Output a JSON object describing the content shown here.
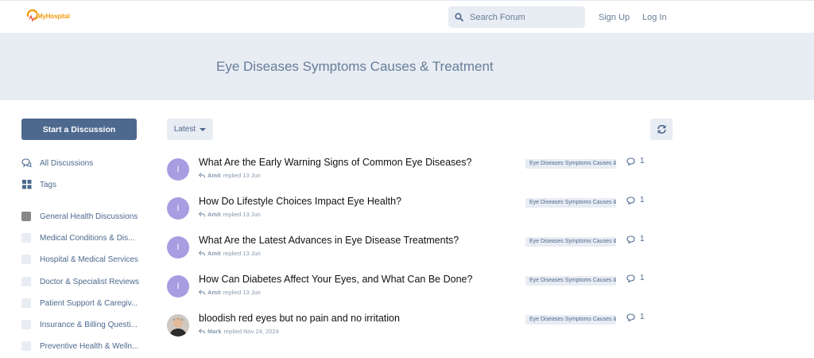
{
  "header": {
    "logo_text": "MyHospital",
    "search_placeholder": "Search Forum",
    "sign_up": "Sign Up",
    "log_in": "Log In"
  },
  "hero": {
    "title": "Eye Diseases Symptoms Causes & Treatment"
  },
  "sidebar": {
    "start_button": "Start a Discussion",
    "nav": [
      {
        "label": "All Discussions",
        "icon": "comments-icon"
      },
      {
        "label": "Tags",
        "icon": "grid-icon"
      }
    ],
    "tags": [
      {
        "label": "General Health Discussions",
        "color": "#888888"
      },
      {
        "label": "Medical Conditions & Dis...",
        "color": "#e8ecf3"
      },
      {
        "label": "Hospital & Medical Services",
        "color": "#e8ecf3"
      },
      {
        "label": "Doctor & Specialist Reviews",
        "color": "#e8ecf3"
      },
      {
        "label": "Patient Support & Caregiv...",
        "color": "#e8ecf3"
      },
      {
        "label": "Insurance & Billing Questi...",
        "color": "#e8ecf3"
      },
      {
        "label": "Preventive Health & Welln...",
        "color": "#e8ecf3"
      }
    ]
  },
  "toolbar": {
    "sort_label": "Latest"
  },
  "discussions": [
    {
      "title": "What Are the Early Warning Signs of Common Eye Diseases?",
      "avatar": "I",
      "user": "Amit",
      "action": "replied",
      "date": "13 Jun",
      "tag": "Eye Diseases Symptoms Causes & Treatment",
      "replies": "1"
    },
    {
      "title": "How Do Lifestyle Choices Impact Eye Health?",
      "avatar": "I",
      "user": "Amit",
      "action": "replied",
      "date": "13 Jun",
      "tag": "Eye Diseases Symptoms Causes & Treatment",
      "replies": "1"
    },
    {
      "title": "What Are the Latest Advances in Eye Disease Treatments?",
      "avatar": "I",
      "user": "Amit",
      "action": "replied",
      "date": "13 Jun",
      "tag": "Eye Diseases Symptoms Causes & Treatment",
      "replies": "1"
    },
    {
      "title": "How Can Diabetes Affect Your Eyes, and What Can Be Done?",
      "avatar": "I",
      "user": "Amit",
      "action": "replied",
      "date": "13 Jun",
      "tag": "Eye Diseases Symptoms Causes & Treatment",
      "replies": "1"
    },
    {
      "title": "bloodish red eyes but no pain and no irritation",
      "avatar": "",
      "user": "Mark",
      "action": "replied",
      "date": "Nov 24, 2024",
      "tag": "Eye Diseases Symptoms Causes & Treatment",
      "replies": "1"
    }
  ],
  "colors": {
    "accent": "#4d698e",
    "hero_bg": "#e8ecf3",
    "avatar_bg": "#a89de0",
    "logo": "#f39c12"
  }
}
